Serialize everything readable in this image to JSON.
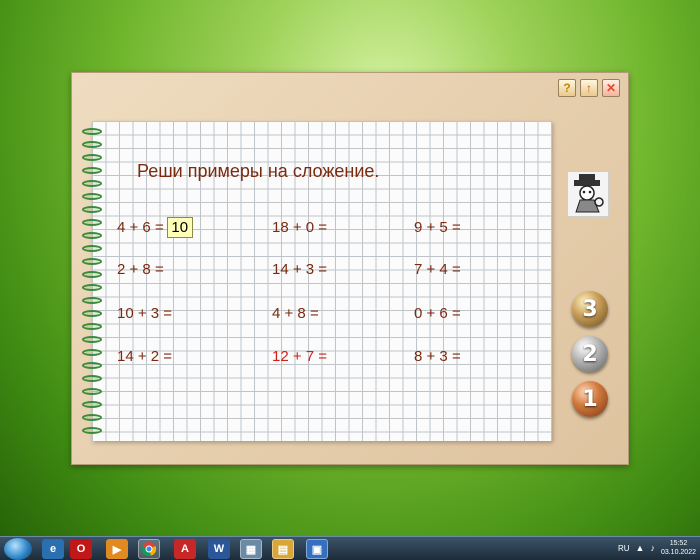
{
  "task_title": "Реши примеры на сложение.",
  "window_buttons": {
    "help": "?",
    "up": "↑",
    "close": "✕"
  },
  "exercises": {
    "col1": [
      {
        "text": "4 + 6 =",
        "answer": "10"
      },
      {
        "text": "2 + 8 ="
      },
      {
        "text": "10 + 3 ="
      },
      {
        "text": "14 + 2 ="
      }
    ],
    "col2": [
      {
        "text": "18 + 0 ="
      },
      {
        "text": "14 + 3 ="
      },
      {
        "text": "4 + 8 ="
      },
      {
        "text": "12 + 7 =",
        "color": "#d0201a"
      }
    ],
    "col3": [
      {
        "text": "9 + 5 ="
      },
      {
        "text": "7 + 4 ="
      },
      {
        "text": "0 + 6 ="
      },
      {
        "text": "8 + 3 ="
      }
    ]
  },
  "level_buttons": [
    "3",
    "2",
    "1"
  ],
  "taskbar": {
    "icons": [
      "explorer-icon",
      "ie-icon",
      "opera-icon",
      "media-player-icon",
      "chrome-icon",
      "pdf-icon",
      "word-icon",
      "photo-viewer-icon",
      "files-icon",
      "notepad-icon",
      "app-icon"
    ],
    "language": "RU",
    "time": "15:52",
    "date": "03.10.2022"
  },
  "colors": {
    "text": "#7a2a10",
    "highlight": "#d0201a",
    "answer_bg": "#ffffb8"
  }
}
